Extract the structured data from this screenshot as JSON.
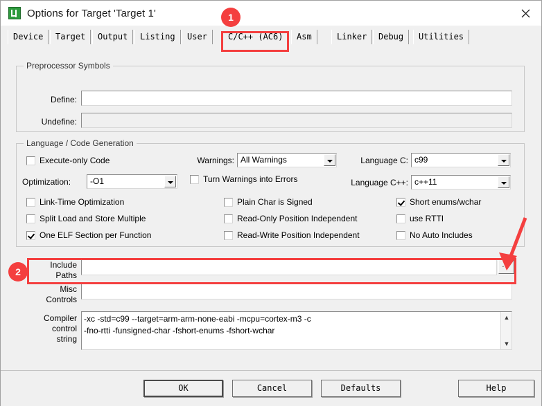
{
  "window": {
    "title": "Options for Target 'Target 1'",
    "app_icon": "uvision-logo-icon",
    "close_icon": "close-icon"
  },
  "tabs": [
    {
      "label": "Device",
      "selected": false
    },
    {
      "label": "Target",
      "selected": false
    },
    {
      "label": "Output",
      "selected": false
    },
    {
      "label": "Listing",
      "selected": false
    },
    {
      "label": "User",
      "selected": false
    },
    {
      "label": "C/C++ (AC6)",
      "selected": true
    },
    {
      "label": "Asm",
      "selected": false
    },
    {
      "label": "Linker",
      "selected": false
    },
    {
      "label": "Debug",
      "selected": false
    },
    {
      "label": "Utilities",
      "selected": false
    }
  ],
  "preprocessor": {
    "group_title": "Preprocessor Symbols",
    "define_label": "Define:",
    "define_value": "",
    "undefine_label": "Undefine:",
    "undefine_value": ""
  },
  "language": {
    "group_title": "Language / Code Generation",
    "execute_only_label": "Execute-only Code",
    "execute_only_checked": false,
    "optimization_label": "Optimization:",
    "optimization_value": "-O1",
    "link_time_opt_label": "Link-Time Optimization",
    "link_time_opt_checked": false,
    "split_load_store_label": "Split Load and Store Multiple",
    "split_load_store_checked": false,
    "one_elf_label": "One ELF Section per Function",
    "one_elf_checked": true,
    "warnings_label": "Warnings:",
    "warnings_value": "All Warnings",
    "warnings_errors_label": "Turn Warnings into Errors",
    "warnings_errors_checked": false,
    "plain_char_label": "Plain Char is Signed",
    "plain_char_checked": false,
    "ro_pos_indep_label": "Read-Only Position Independent",
    "ro_pos_indep_checked": false,
    "rw_pos_indep_label": "Read-Write Position Independent",
    "rw_pos_indep_checked": false,
    "language_c_label": "Language C:",
    "language_c_value": "c99",
    "language_cpp_label": "Language C++:",
    "language_cpp_value": "c++11",
    "short_enums_label": "Short enums/wchar",
    "short_enums_checked": true,
    "use_rtti_label": "use RTTI",
    "use_rtti_checked": false,
    "no_auto_includes_label": "No Auto Includes",
    "no_auto_includes_checked": false
  },
  "paths": {
    "include_label_line1": "Include",
    "include_label_line2": "Paths",
    "include_value": "",
    "browse_label": "...",
    "misc_label_line1": "Misc",
    "misc_label_line2": "Controls",
    "misc_value": "",
    "compiler_label_line1": "Compiler",
    "compiler_label_line2": "control",
    "compiler_label_line3": "string",
    "compiler_value": "-xc -std=c99 --target=arm-arm-none-eabi -mcpu=cortex-m3 -c\n-fno-rtti -funsigned-char -fshort-enums -fshort-wchar",
    "scroll_up_icon": "chevron-up-icon",
    "scroll_down_icon": "chevron-down-icon"
  },
  "buttons": {
    "ok": "OK",
    "cancel": "Cancel",
    "defaults": "Defaults",
    "help": "Help"
  },
  "annotations": {
    "accent_color": "#f43f3f",
    "badge_1": "1",
    "badge_2": "2"
  }
}
